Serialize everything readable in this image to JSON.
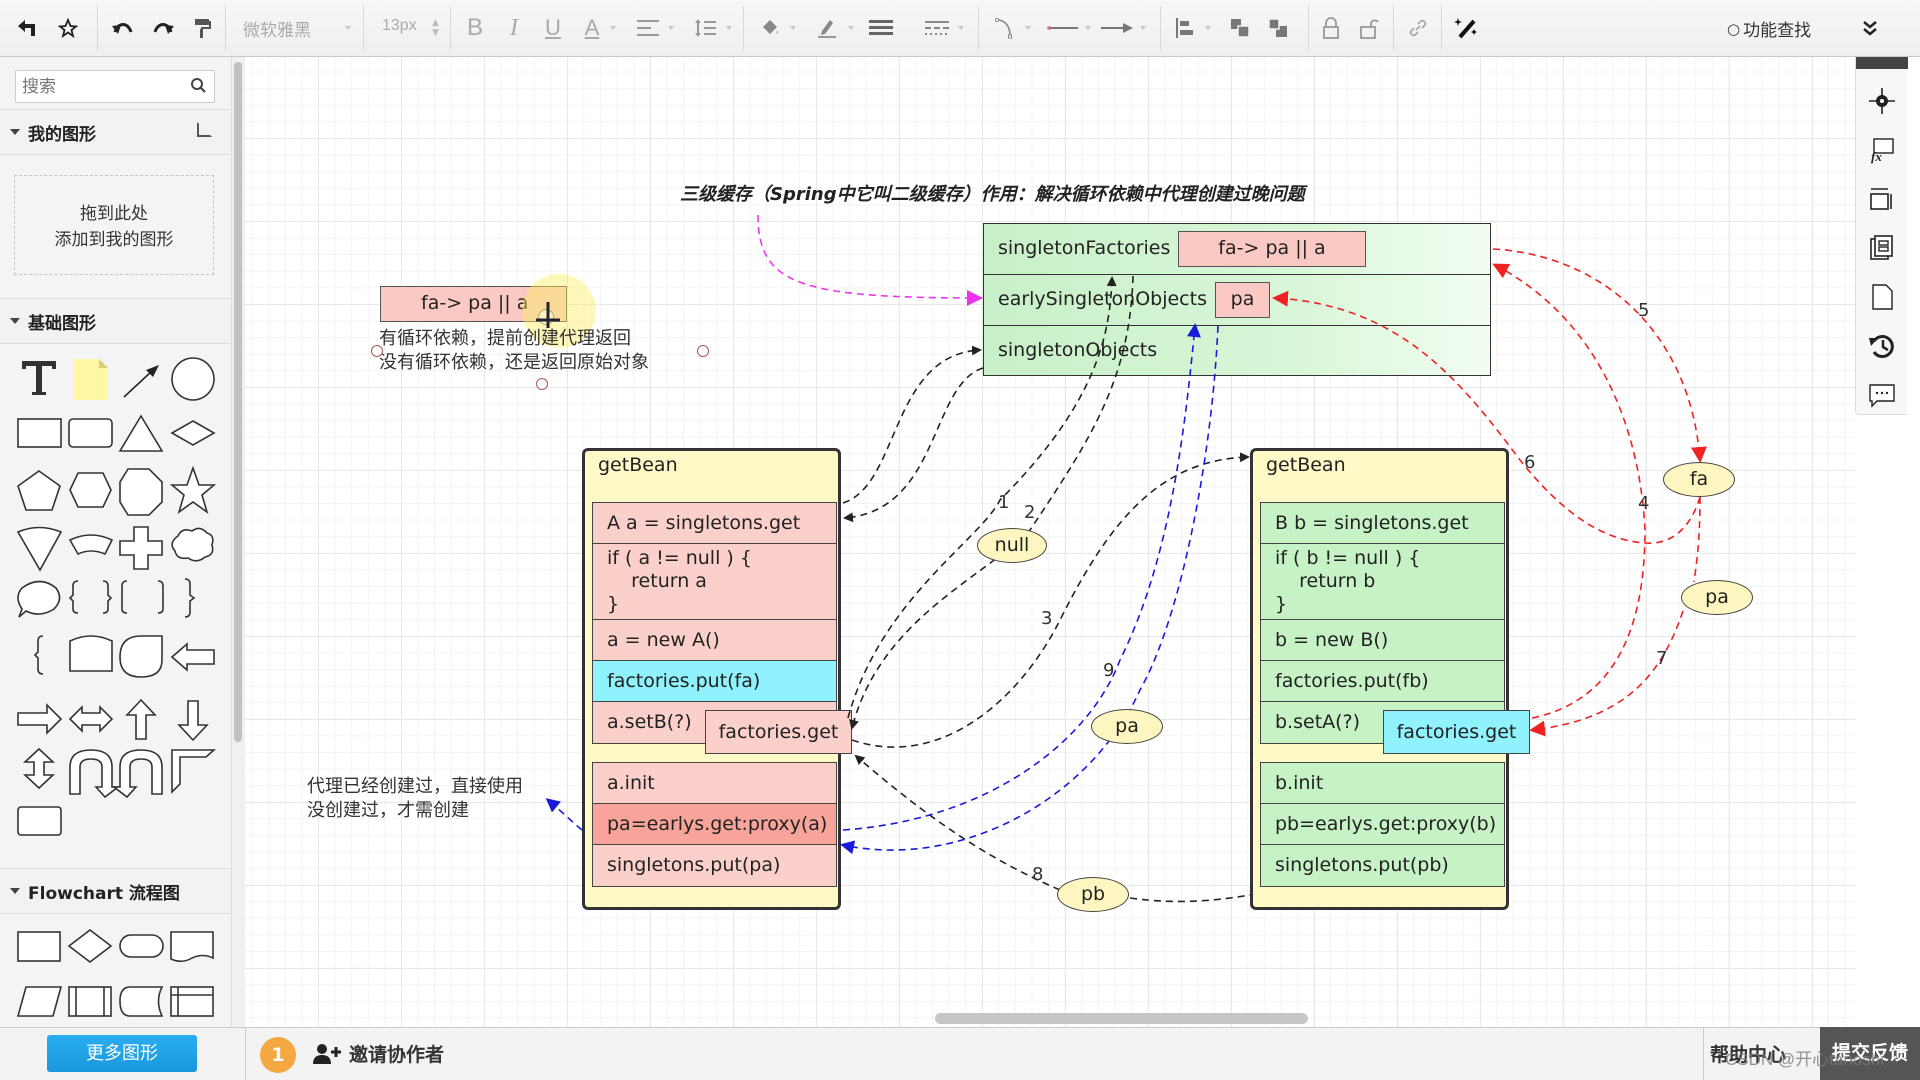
{
  "toolbar": {
    "font_family": "微软雅黑",
    "font_size": "13px",
    "find_label": "功能查找",
    "icons": [
      "back-icon",
      "pin-icon",
      "undo-icon",
      "redo-icon",
      "format-painter-icon",
      "bold-icon",
      "italic-icon",
      "underline-icon",
      "font-color-icon",
      "align-icon",
      "line-spacing-icon",
      "fill-color-icon",
      "line-color-icon",
      "line-width-icon",
      "line-style-icon",
      "connector-curve-icon",
      "line-start-icon",
      "line-end-icon",
      "align-left-icon",
      "bring-front-icon",
      "send-back-icon",
      "lock-icon",
      "unlock-icon",
      "link-icon",
      "magic-wand-icon",
      "collapse-icon"
    ]
  },
  "sidebar": {
    "search_placeholder": "搜索",
    "my_shapes_title": "我的图形",
    "drop_hint_line1": "拖到此处",
    "drop_hint_line2": "添加到我的图形",
    "basic_shapes_title": "基础图形",
    "flowchart_title": "Flowchart 流程图",
    "more_shapes_button": "更多图形"
  },
  "bottombar": {
    "collaborator_count": "1",
    "invite_label": "邀请协作者",
    "help_label": "帮助中心",
    "feedback_label": "提交反馈",
    "watermark": "CSDN @开心tanoshi"
  },
  "diagram": {
    "title": "三级缓存（Spring中它叫二级缓存）作用：解决循环依赖中代理创建过晚问题",
    "cache": {
      "rows": [
        {
          "label": "singletonFactories",
          "value": "fa-> pa || a"
        },
        {
          "label": "earlySingletonObjects",
          "value": "pa"
        },
        {
          "label": "singletonObjects",
          "value": ""
        }
      ]
    },
    "side_note": {
      "box": "fa-> pa || a",
      "line1": "有循环依赖，提前创建代理返回",
      "line2": "没有循环依赖，还是返回原始对象"
    },
    "proxy_note": {
      "line1": "代理已经创建过，直接使用",
      "line2": "没创建过，才需创建"
    },
    "bean_a": {
      "header": "getBean",
      "rows": [
        "A a = singletons.get",
        "if ( a != null ) {\n    return a\n}",
        "a = new A()",
        "factories.put(fa)",
        "a.setB(?)",
        "a.init",
        "pa=earlys.get:proxy(a)",
        "singletons.put(pa)"
      ],
      "factories_get": "factories.get"
    },
    "bean_b": {
      "header": "getBean",
      "rows": [
        "B b = singletons.get",
        "if ( b != null ) {\n    return b\n}",
        "b = new B()",
        "factories.put(fb)",
        "b.setA(?)",
        "b.init",
        "pb=earlys.get:proxy(b)",
        "singletons.put(pb)"
      ],
      "factories_get": "factories.get"
    },
    "ellipses": {
      "null": "null",
      "pa_mid": "pa",
      "pb": "pb",
      "fa": "fa",
      "pa_right": "pa"
    },
    "step_labels": [
      "1",
      "2",
      "3",
      "4",
      "5",
      "6",
      "7",
      "8",
      "9"
    ],
    "colors": {
      "black_link": "#222222",
      "blue_link": "#1a1adb",
      "red_link": "#ee2222",
      "magenta_link": "#ee33ee"
    }
  }
}
